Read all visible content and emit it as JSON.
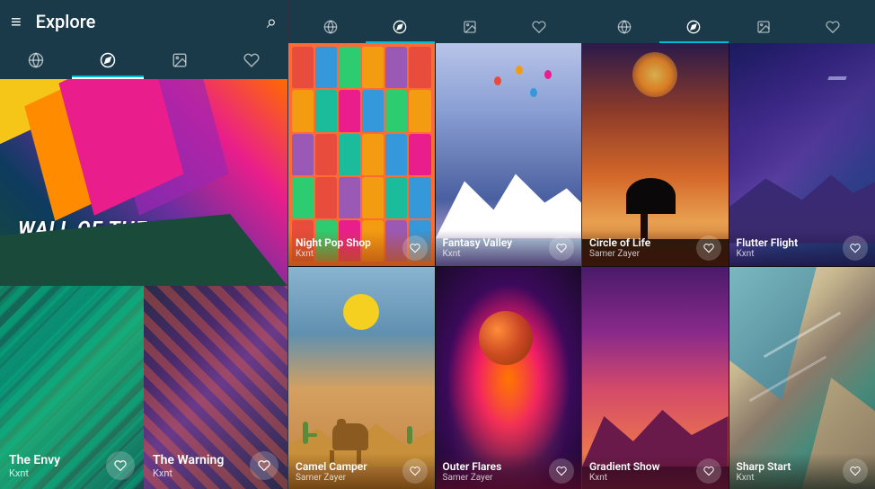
{
  "leftPanel": {
    "header": {
      "title": "Explore",
      "menuIcon": "☰",
      "searchIcon": "⌕"
    },
    "nav": [
      {
        "icon": "🌐",
        "active": false
      },
      {
        "icon": "◉",
        "active": true
      },
      {
        "icon": "🖼",
        "active": false
      },
      {
        "icon": "♡",
        "active": false
      }
    ],
    "wallOfDay": {
      "label": "WALL OF THE DAY"
    },
    "bottomCards": [
      {
        "title": "The Envy",
        "author": "Kxnt"
      },
      {
        "title": "The Warning",
        "author": "Kxnt"
      }
    ]
  },
  "middlePanel": {
    "nav": [
      {
        "icon": "🌐",
        "active": false
      },
      {
        "icon": "◉",
        "active": true
      },
      {
        "icon": "🖼",
        "active": false
      },
      {
        "icon": "♡",
        "active": false
      }
    ],
    "cards": [
      {
        "title": "Night Pop Shop",
        "author": "Kxnt"
      },
      {
        "title": "Fantasy Valley",
        "author": "Kxnt"
      },
      {
        "title": "Camel Camper",
        "author": "Samer Zayer"
      },
      {
        "title": "Outer Flares",
        "author": "Samer Zayer"
      }
    ]
  },
  "rightPanel": {
    "nav": [
      {
        "icon": "🌐",
        "active": false
      },
      {
        "icon": "◉",
        "active": true
      },
      {
        "icon": "🖼",
        "active": false
      },
      {
        "icon": "♡",
        "active": false
      }
    ],
    "cards": [
      {
        "title": "Circle of Life",
        "author": "Samer Zayer"
      },
      {
        "title": "Flutter Flight",
        "author": "Kxnt"
      },
      {
        "title": "Gradient Show",
        "author": "Kxnt"
      },
      {
        "title": "Sharp Start",
        "author": "Kxnt"
      }
    ]
  },
  "icons": {
    "heart": "♡",
    "compass": "◎",
    "globe": "○",
    "image": "▣",
    "menu": "≡",
    "search": "⌕"
  },
  "colors": {
    "headerBg": "#1a3a4a",
    "accent": "#00bcd4",
    "cardOverlay": "rgba(0,0,0,0.5)"
  }
}
